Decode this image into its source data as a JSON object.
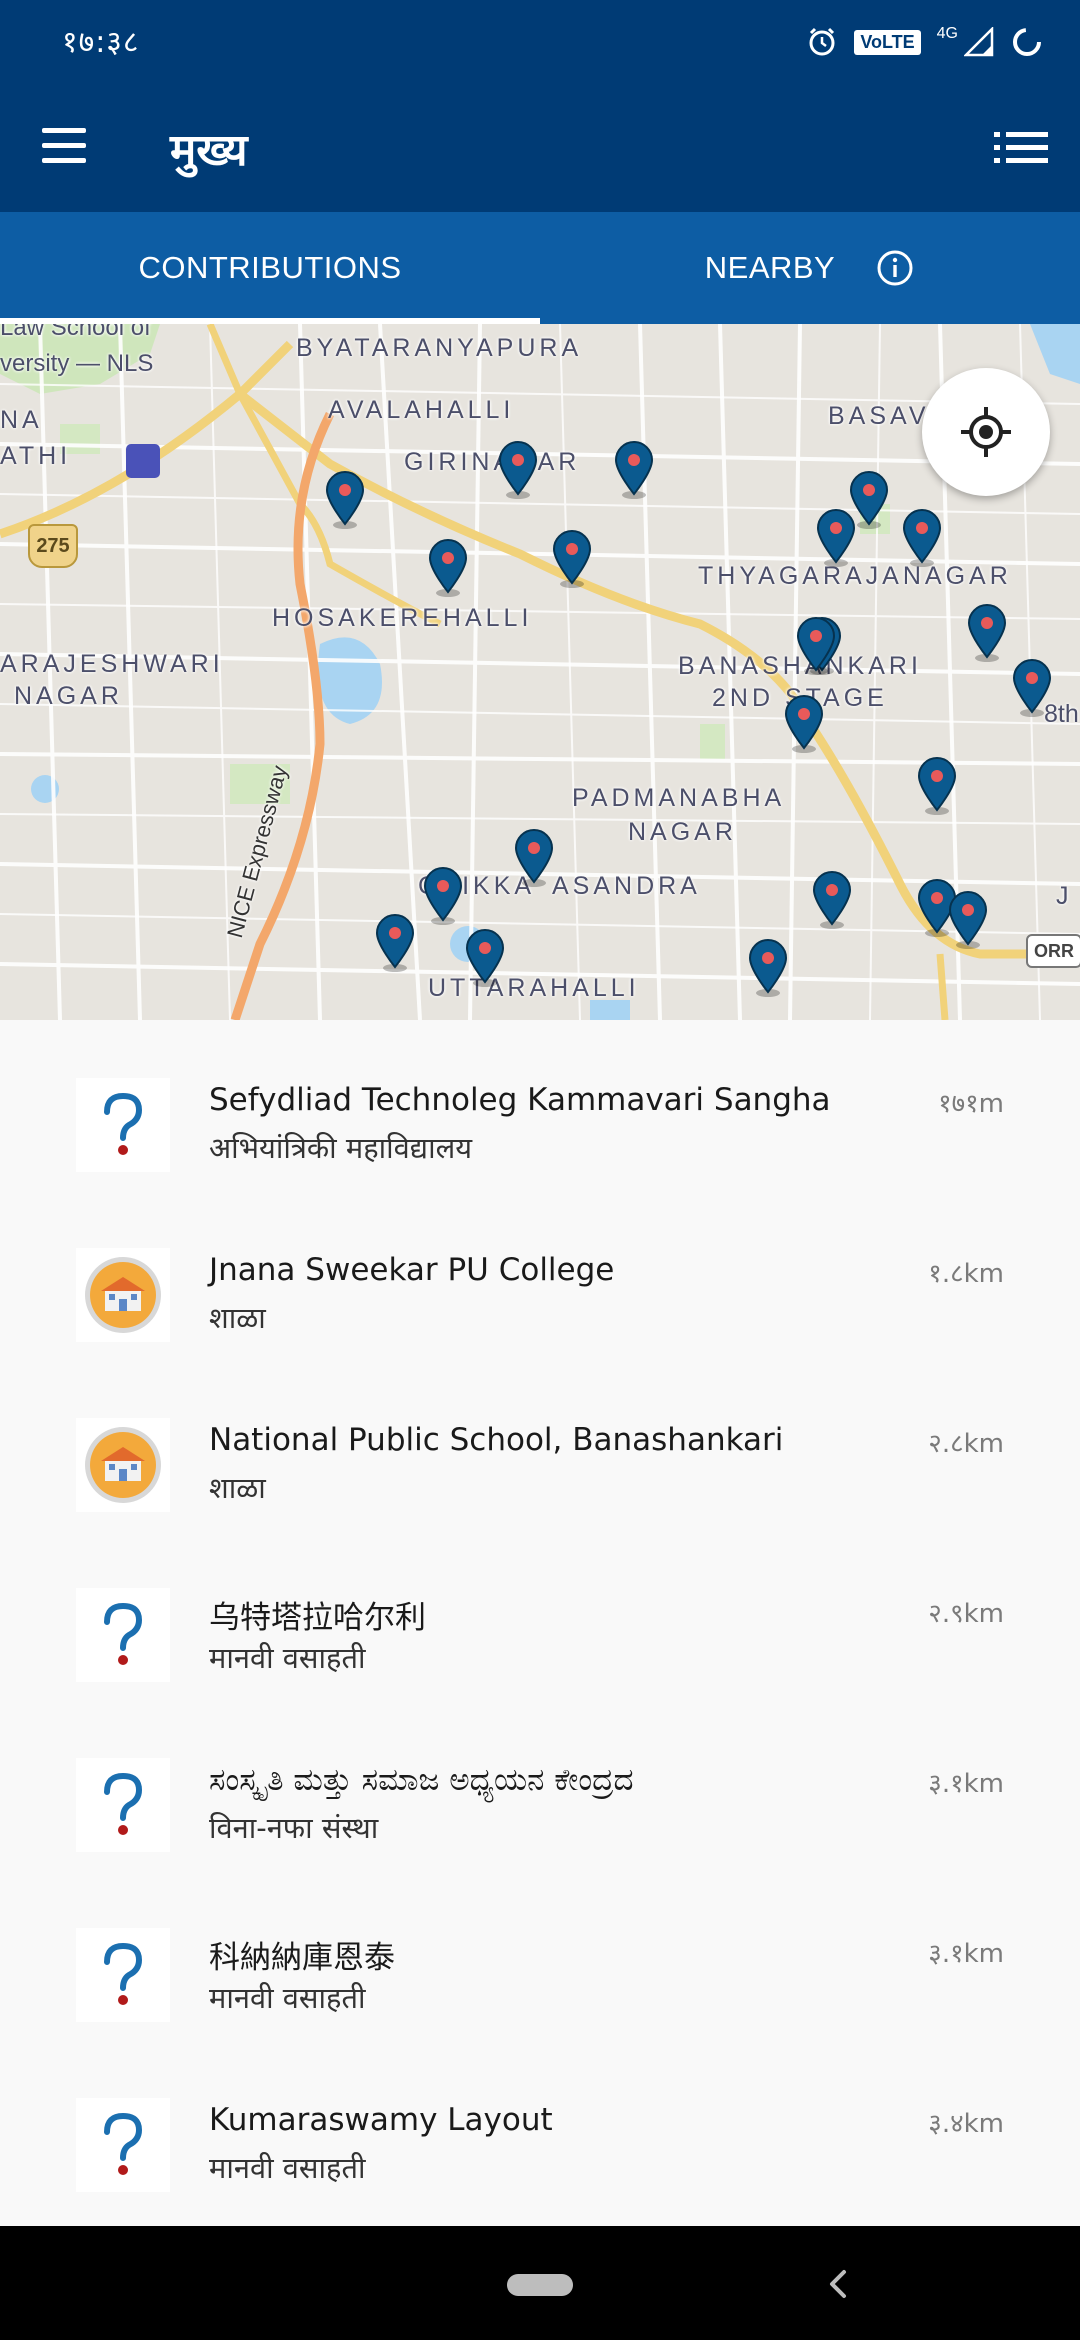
{
  "status_bar": {
    "time": "१७:३८",
    "volte": "VoLTE",
    "network": "4G"
  },
  "app_bar": {
    "title": "मुख्य",
    "menu_icon": "hamburger-menu-icon",
    "list_icon": "list-view-icon"
  },
  "tabs": [
    {
      "label": "CONTRIBUTIONS",
      "selected": true
    },
    {
      "label": "NEARBY",
      "selected": false
    }
  ],
  "map": {
    "labels": [
      "Law School of",
      "versity — NLS",
      "BYATARANYAPURA",
      "AVALAHALLI",
      "GIRINAGAR",
      "BASAVA",
      "NA",
      "ATHI",
      "275",
      "THYAGARAJANAGAR",
      "HOSAKEREHALLI",
      "ARAJESHWARI",
      "NAGAR",
      "BANASHANKARI",
      "2ND STAGE",
      "8th",
      "PADMANABHA",
      "NAGAR",
      "CHIKKA",
      "ASANDRA",
      "NICE Expressway",
      "UTTARAHALLI",
      "ORR",
      "J"
    ],
    "locate_icon": "my-location-icon"
  },
  "places": [
    {
      "name": "Sefydliad Technoleg Kammavari Sangha",
      "type": "अभियांत्रिकी महाविद्यालय",
      "distance": "१७१m",
      "icon": "unknown-question-icon"
    },
    {
      "name": "Jnana Sweekar PU College",
      "type": "शाळा",
      "distance": "१.८km",
      "icon": "school-icon"
    },
    {
      "name": "National Public School, Banashankari",
      "type": "शाळा",
      "distance": "२.८km",
      "icon": "school-icon"
    },
    {
      "name": "乌特塔拉哈尔利",
      "type": "मानवी वसाहती",
      "distance": "२.९km",
      "icon": "unknown-question-icon"
    },
    {
      "name": "ಸಂಸ್ಕೃತಿ ಮತ್ತು ಸಮಾಜ ಅಧ್ಯಯನ ಕೇಂದ್ರದ",
      "type": "विना-नफा संस्था",
      "distance": "३.१km",
      "icon": "unknown-question-icon"
    },
    {
      "name": "科納納庫恩泰",
      "type": "मानवी वसाहती",
      "distance": "३.१km",
      "icon": "unknown-question-icon"
    },
    {
      "name": "Kumaraswamy Layout",
      "type": "मानवी वसाहती",
      "distance": "३.४km",
      "icon": "unknown-question-icon"
    }
  ],
  "colors": {
    "app_bar": "#003b75",
    "tabs": "#0d5da4",
    "pin": "#0b5a8f",
    "pin_dot": "#e85a5a"
  }
}
